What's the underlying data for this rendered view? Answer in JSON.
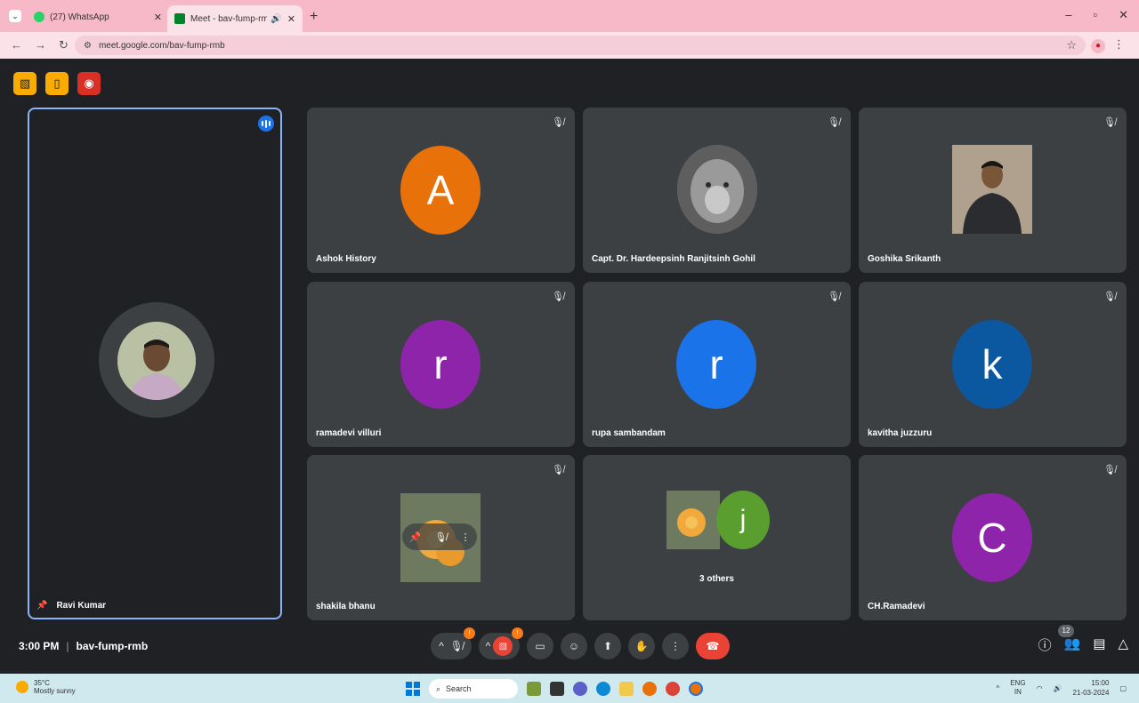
{
  "browser": {
    "tabs": [
      {
        "title": "(27) WhatsApp",
        "close": "✕"
      },
      {
        "title": "Meet - bav-fump-rmb",
        "close": "✕",
        "audio": "🔊"
      }
    ],
    "new_tab": "+",
    "url": "meet.google.com/bav-fump-rmb",
    "window_controls": [
      "–",
      "▫",
      "✕"
    ]
  },
  "meeting": {
    "time": "3:00 PM",
    "separator": "|",
    "code": "bav-fump-rmb",
    "participant_count": "12",
    "mic_badge": "!",
    "cam_badge": "!"
  },
  "main_participant": {
    "name": "Ravi Kumar"
  },
  "participants": [
    {
      "name": "Ashok History",
      "initial": "A",
      "color": "#e8710a"
    },
    {
      "name": "Capt. Dr. Hardeepsinh Ranjitsinh Gohil",
      "initial": "",
      "color": "#777777"
    },
    {
      "name": "Goshika Srikanth",
      "initial": "",
      "color": "#8a7a6a"
    },
    {
      "name": "ramadevi villuri",
      "initial": "r",
      "color": "#8e24aa"
    },
    {
      "name": "rupa sambandam",
      "initial": "r",
      "color": "#1a73e8"
    },
    {
      "name": "kavitha juzzuru",
      "initial": "k",
      "color": "#0b57a0"
    },
    {
      "name": "shakila bhanu",
      "initial": "",
      "color": "#c79a2a"
    },
    {
      "name": "3 others",
      "initial": "j",
      "color": "#5a9e2f"
    },
    {
      "name": "CH.Ramadevi",
      "initial": "C",
      "color": "#8e24aa"
    }
  ],
  "taskbar": {
    "temperature": "35°C",
    "weather": "Mostly sunny",
    "search": "Search",
    "lang": "ENG",
    "region": "IN",
    "time": "15:00",
    "date": "21-03-2024"
  }
}
